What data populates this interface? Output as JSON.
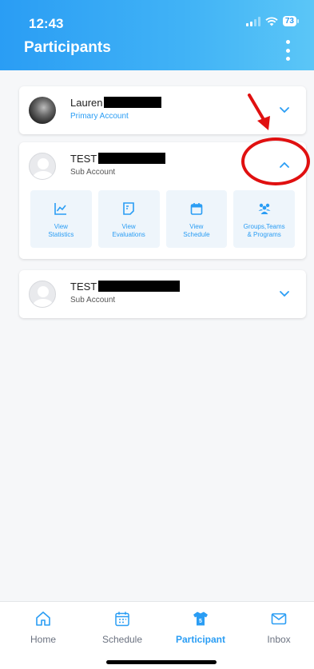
{
  "status_bar": {
    "time": "12:43",
    "battery": "73"
  },
  "header": {
    "title": "Participants"
  },
  "participants": [
    {
      "name": "Lauren",
      "account_type": "Primary Account",
      "expanded": false
    },
    {
      "name": "TEST",
      "account_type": "Sub Account",
      "expanded": true,
      "actions": [
        {
          "label": "View\nStatistics",
          "icon": "chart-line-icon"
        },
        {
          "label": "View\nEvaluations",
          "icon": "evaluation-note-icon"
        },
        {
          "label": "View\nSchedule",
          "icon": "calendar-icon"
        },
        {
          "label": "Groups,Teams\n& Programs",
          "icon": "group-people-icon"
        }
      ]
    },
    {
      "name": "TEST",
      "account_type": "Sub Account",
      "expanded": false
    }
  ],
  "tabbar": {
    "tabs": [
      {
        "label": "Home",
        "icon": "home-icon"
      },
      {
        "label": "Schedule",
        "icon": "calendar-icon"
      },
      {
        "label": "Participant",
        "icon": "jersey-icon",
        "badge": "5"
      },
      {
        "label": "Inbox",
        "icon": "mail-icon"
      }
    ],
    "active": "Participant"
  },
  "colors": {
    "accent": "#2a9df4",
    "annotation": "#e01010"
  }
}
